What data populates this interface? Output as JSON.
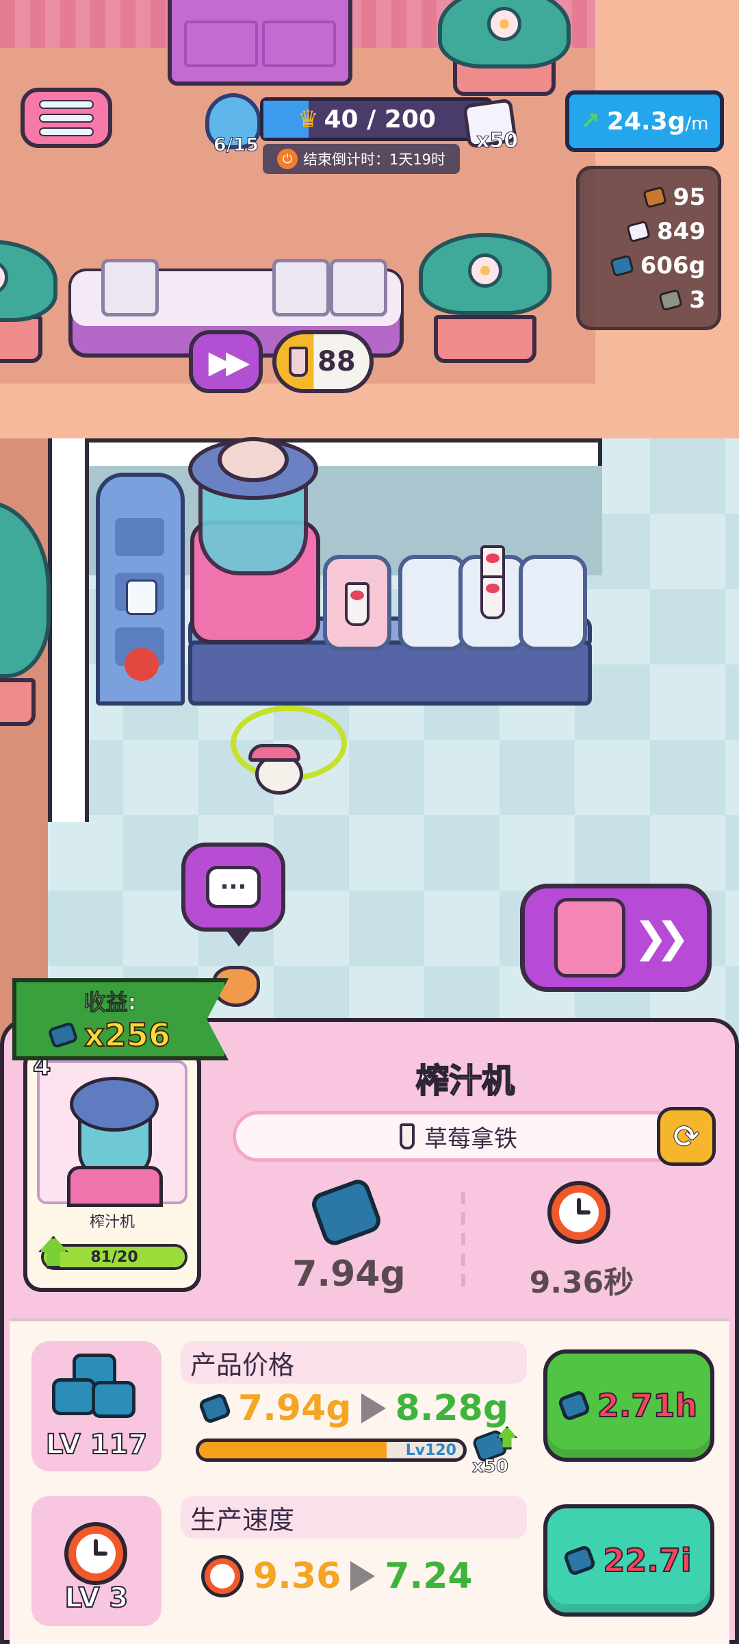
{
  "hud": {
    "trophy_progress": "6/15",
    "crown_progress": "40 / 200",
    "crown_fill_fraction": 0.2,
    "gem_multiplier": "x50",
    "countdown_label": "结束倒计时：1天19时",
    "income_rate_value": "24.3g",
    "income_rate_unit": "/m"
  },
  "resources": [
    {
      "name": "wood",
      "icon": "wood-chunk-icon",
      "value": "95",
      "color": "#c8772f"
    },
    {
      "name": "crystal",
      "icon": "white-crystal-icon",
      "value": "849",
      "color": "#f2eefc"
    },
    {
      "name": "ore",
      "icon": "blue-ore-icon",
      "value": "606g",
      "color": "#2b77a6"
    },
    {
      "name": "stone",
      "icon": "stone-icon",
      "value": "3",
      "color": "#8e9284"
    }
  ],
  "scene": {
    "fast_forward_icon": "fast-forward-icon",
    "stock_count": "88",
    "chat_icon": "chat-bubble-icon"
  },
  "income": {
    "label": "收益:",
    "value": "x256"
  },
  "machine_card": {
    "level": "4",
    "name": "榨汁机",
    "xp_text": "81/20",
    "xp_fraction": 1.0
  },
  "machine": {
    "title": "榨汁机",
    "product": "草莓拿铁",
    "price": "7.94g",
    "speed": "9.36秒"
  },
  "upgrades": {
    "price": {
      "level_label": "LV 117",
      "title": "产品价格",
      "old": "7.94g",
      "new": "8.28g",
      "progress_fraction": 0.71,
      "milestone": "Lv120",
      "milestone_mult": "x50",
      "cost": "2.71h",
      "button_color": "#52c444"
    },
    "speed": {
      "level_label": "LV 3",
      "title": "生产速度",
      "old": "9.36",
      "new": "7.24",
      "cost": "22.7i",
      "button_color": "#3ed2b0"
    }
  }
}
